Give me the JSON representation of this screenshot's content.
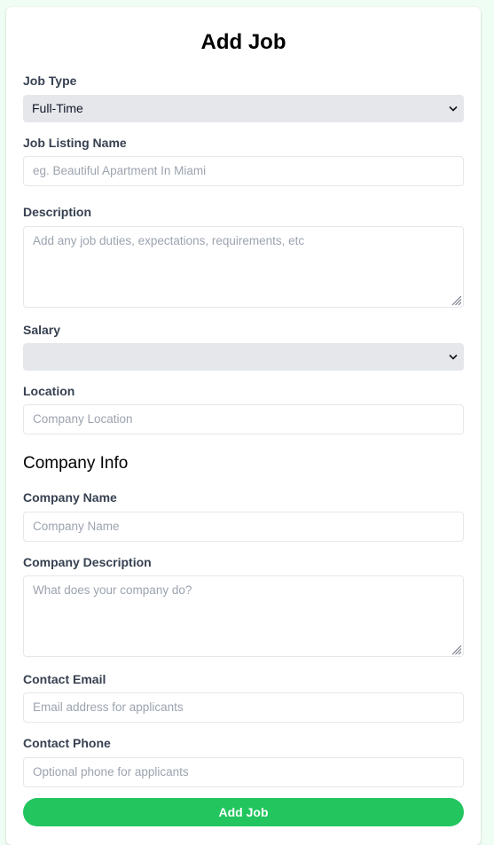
{
  "form": {
    "title": "Add Job",
    "job_type": {
      "label": "Job Type",
      "value": "Full-Time"
    },
    "job_listing_name": {
      "label": "Job Listing Name",
      "placeholder": "eg. Beautiful Apartment In Miami"
    },
    "description": {
      "label": "Description",
      "placeholder": "Add any job duties, expectations, requirements, etc"
    },
    "salary": {
      "label": "Salary",
      "value": ""
    },
    "location": {
      "label": "Location",
      "placeholder": "Company Location"
    },
    "company_section_title": "Company Info",
    "company_name": {
      "label": "Company Name",
      "placeholder": "Company Name"
    },
    "company_description": {
      "label": "Company Description",
      "placeholder": "What does your company do?"
    },
    "contact_email": {
      "label": "Contact Email",
      "placeholder": "Email address for applicants"
    },
    "contact_phone": {
      "label": "Contact Phone",
      "placeholder": "Optional phone for applicants"
    },
    "submit_label": "Add Job"
  },
  "colors": {
    "page_background": "#f0fdf4",
    "accent": "#22c55e",
    "select_background": "#e5e7eb",
    "placeholder_text": "#9ca3af",
    "label_text": "#374151"
  },
  "icons": {
    "select_chevron": "chevron-down-icon",
    "textarea_grip": "resize-grip-icon"
  }
}
